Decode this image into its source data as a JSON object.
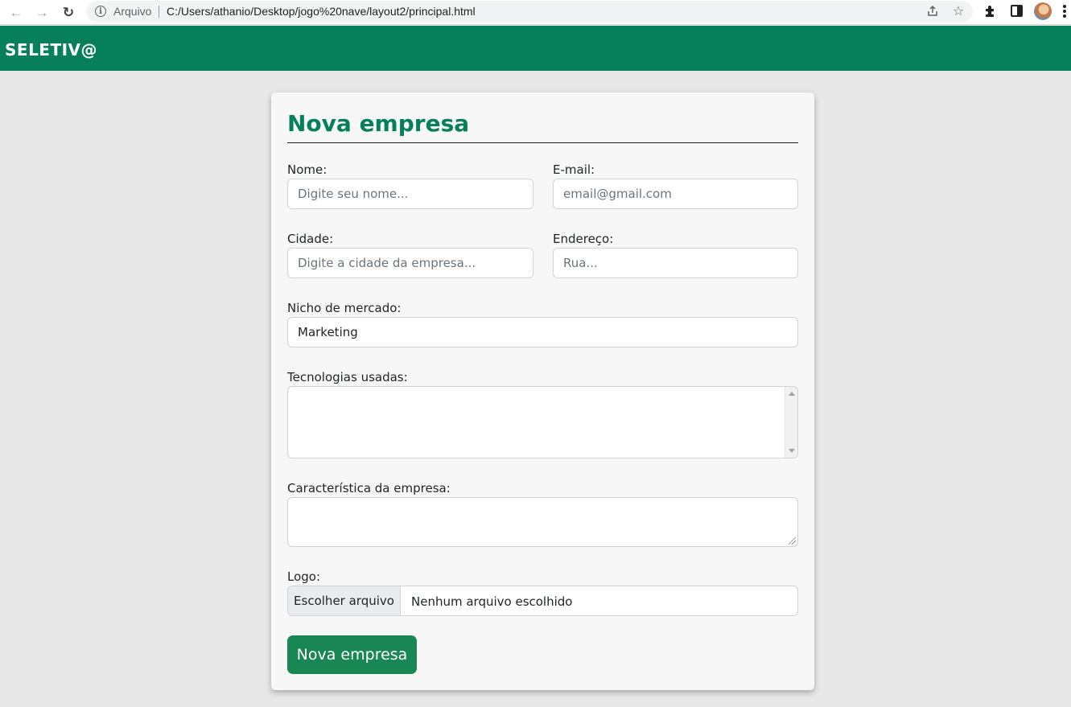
{
  "browser": {
    "scheme_label": "Arquivo",
    "url": "C:/Users/athanio/Desktop/jogo%20nave/layout2/principal.html"
  },
  "app": {
    "brand": "SELETIV@",
    "colors": {
      "header": "#067f5a",
      "title": "#067f5a",
      "button": "#198754"
    }
  },
  "form": {
    "title": "Nova empresa",
    "fields": {
      "nome": {
        "label": "Nome:",
        "placeholder": "Digite seu nome..."
      },
      "email": {
        "label": "E-mail:",
        "placeholder": "email@gmail.com"
      },
      "cidade": {
        "label": "Cidade:",
        "placeholder": "Digite a cidade da empresa..."
      },
      "endereco": {
        "label": "Endereço:",
        "placeholder": "Rua..."
      },
      "nicho": {
        "label": "Nicho de mercado:",
        "value": "Marketing"
      },
      "tecnologias": {
        "label": "Tecnologias usadas:",
        "value": ""
      },
      "caracteristica": {
        "label": "Característica da empresa:",
        "value": ""
      },
      "logo": {
        "label": "Logo:",
        "button": "Escolher arquivo",
        "status": "Nenhum arquivo escolhido"
      }
    },
    "submit_label": "Nova empresa"
  },
  "icons": [
    "back-icon",
    "forward-icon",
    "reload-icon",
    "info-icon",
    "share-icon",
    "star-icon",
    "extensions-icon",
    "side-panel-icon",
    "profile-avatar",
    "menu-icon"
  ]
}
